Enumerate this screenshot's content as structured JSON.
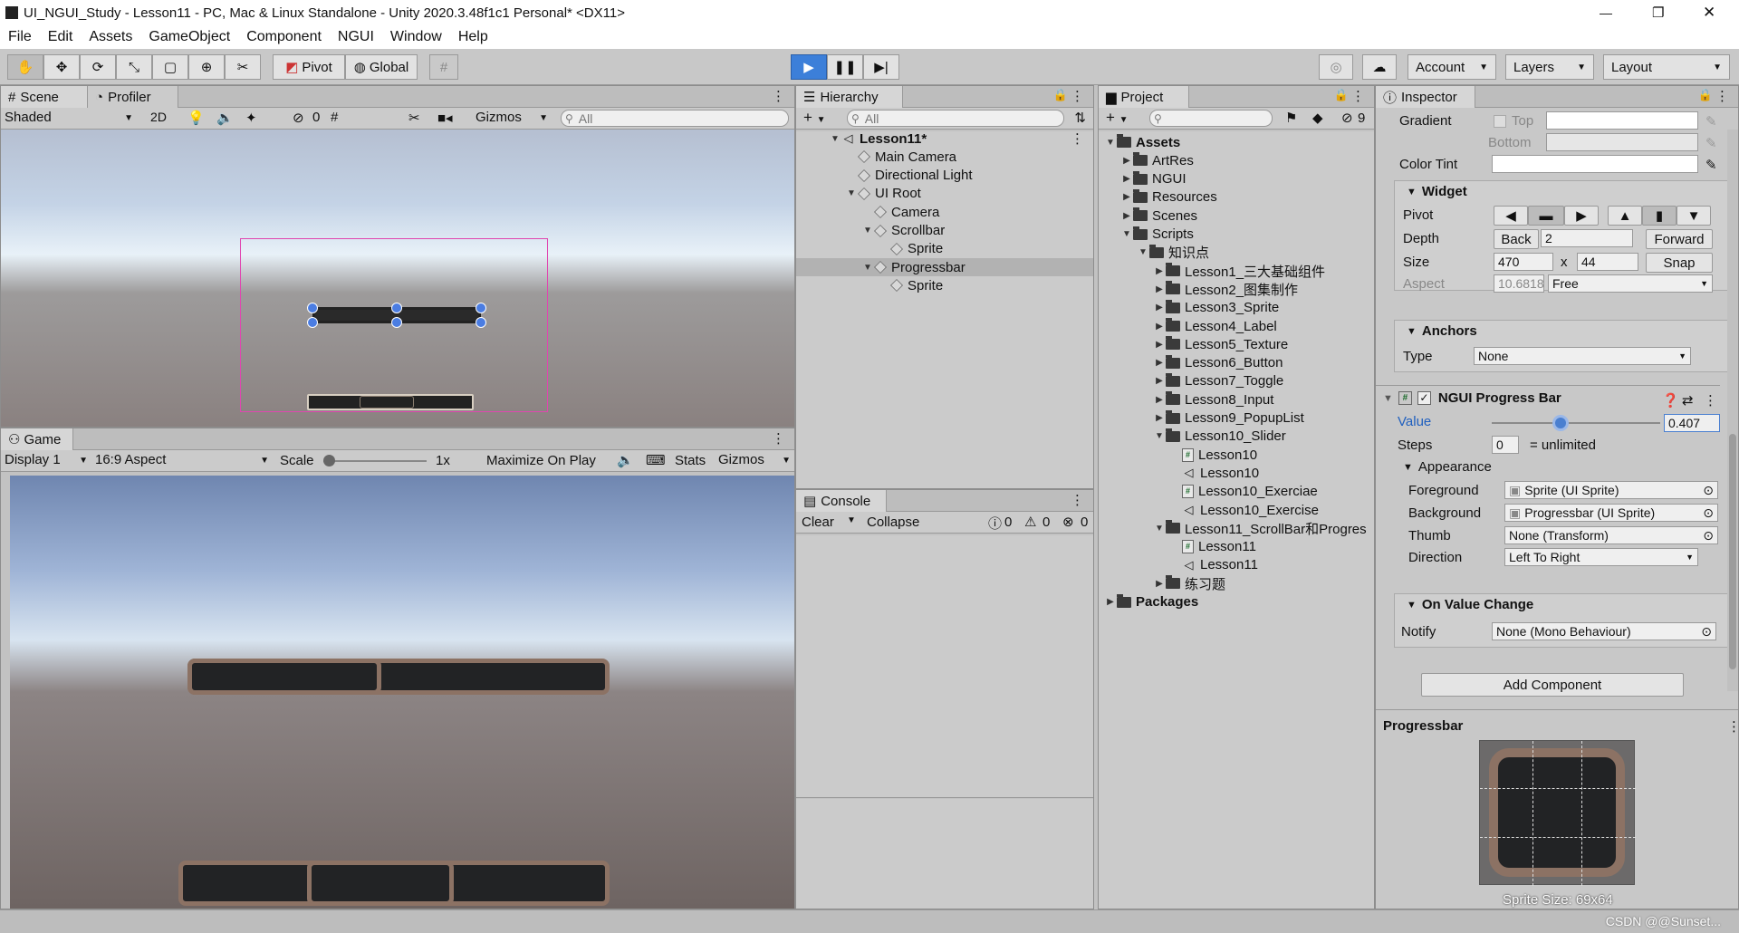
{
  "window": {
    "title": "UI_NGUI_Study - Lesson11 - PC, Mac & Linux Standalone - Unity 2020.3.48f1c1 Personal* <DX11>",
    "controls": [
      "—",
      "❐",
      "✕"
    ]
  },
  "menu": [
    "File",
    "Edit",
    "Assets",
    "GameObject",
    "Component",
    "NGUI",
    "Window",
    "Help"
  ],
  "toolbar": {
    "pivot": "Pivot",
    "global": "Global",
    "account": "Account",
    "layers": "Layers",
    "layout": "Layout"
  },
  "scene": {
    "tab_scene": "Scene",
    "tab_profiler": "Profiler",
    "shading": "Shaded",
    "mode_2d": "2D",
    "gizmos": "Gizmos",
    "search_placeholder": "All",
    "hidden_count": "0"
  },
  "game": {
    "tab": "Game",
    "display": "Display 1",
    "aspect": "16:9 Aspect",
    "scale_label": "Scale",
    "scale_value": "1x",
    "maximize": "Maximize On Play",
    "stats": "Stats",
    "gizmos": "Gizmos"
  },
  "hierarchy": {
    "tab": "Hierarchy",
    "search_placeholder": "All",
    "items": [
      {
        "label": "Lesson11*",
        "depth": 0,
        "fold": "▼",
        "bold": true,
        "type": "scene"
      },
      {
        "label": "Main Camera",
        "depth": 1,
        "fold": "",
        "type": "go"
      },
      {
        "label": "Directional Light",
        "depth": 1,
        "fold": "",
        "type": "go"
      },
      {
        "label": "UI Root",
        "depth": 1,
        "fold": "▼",
        "type": "go"
      },
      {
        "label": "Camera",
        "depth": 2,
        "fold": "",
        "type": "go"
      },
      {
        "label": "Scrollbar",
        "depth": 2,
        "fold": "▼",
        "type": "go"
      },
      {
        "label": "Sprite",
        "depth": 3,
        "fold": "",
        "type": "go"
      },
      {
        "label": "Progressbar",
        "depth": 2,
        "fold": "▼",
        "type": "go",
        "selected": true
      },
      {
        "label": "Sprite",
        "depth": 3,
        "fold": "",
        "type": "go"
      }
    ]
  },
  "console": {
    "tab": "Console",
    "clear": "Clear",
    "collapse": "Collapse",
    "info_count": "0",
    "warn_count": "0",
    "error_count": "0"
  },
  "project": {
    "tab": "Project",
    "badge": "9",
    "items": [
      {
        "label": "Assets",
        "depth": 0,
        "fold": "▼",
        "bold": true,
        "type": "folder"
      },
      {
        "label": "ArtRes",
        "depth": 1,
        "fold": "▶",
        "type": "folder"
      },
      {
        "label": "NGUI",
        "depth": 1,
        "fold": "▶",
        "type": "folder"
      },
      {
        "label": "Resources",
        "depth": 1,
        "fold": "▶",
        "type": "folder"
      },
      {
        "label": "Scenes",
        "depth": 1,
        "fold": "▶",
        "type": "folder"
      },
      {
        "label": "Scripts",
        "depth": 1,
        "fold": "▼",
        "type": "folder"
      },
      {
        "label": "知识点",
        "depth": 2,
        "fold": "▼",
        "type": "folder"
      },
      {
        "label": "Lesson1_三大基础组件",
        "depth": 3,
        "fold": "▶",
        "type": "folder"
      },
      {
        "label": "Lesson2_图集制作",
        "depth": 3,
        "fold": "▶",
        "type": "folder"
      },
      {
        "label": "Lesson3_Sprite",
        "depth": 3,
        "fold": "▶",
        "type": "folder"
      },
      {
        "label": "Lesson4_Label",
        "depth": 3,
        "fold": "▶",
        "type": "folder"
      },
      {
        "label": "Lesson5_Texture",
        "depth": 3,
        "fold": "▶",
        "type": "folder"
      },
      {
        "label": "Lesson6_Button",
        "depth": 3,
        "fold": "▶",
        "type": "folder"
      },
      {
        "label": "Lesson7_Toggle",
        "depth": 3,
        "fold": "▶",
        "type": "folder"
      },
      {
        "label": "Lesson8_Input",
        "depth": 3,
        "fold": "▶",
        "type": "folder"
      },
      {
        "label": "Lesson9_PopupList",
        "depth": 3,
        "fold": "▶",
        "type": "folder"
      },
      {
        "label": "Lesson10_Slider",
        "depth": 3,
        "fold": "▼",
        "type": "folder"
      },
      {
        "label": "Lesson10",
        "depth": 4,
        "fold": "",
        "type": "script"
      },
      {
        "label": "Lesson10",
        "depth": 4,
        "fold": "",
        "type": "scene"
      },
      {
        "label": "Lesson10_Exerciae",
        "depth": 4,
        "fold": "",
        "type": "script"
      },
      {
        "label": "Lesson10_Exercise",
        "depth": 4,
        "fold": "",
        "type": "scene"
      },
      {
        "label": "Lesson11_ScrollBar和Progres",
        "depth": 3,
        "fold": "▼",
        "type": "folder"
      },
      {
        "label": "Lesson11",
        "depth": 4,
        "fold": "",
        "type": "script"
      },
      {
        "label": "Lesson11",
        "depth": 4,
        "fold": "",
        "type": "scene"
      },
      {
        "label": "练习题",
        "depth": 3,
        "fold": "▶",
        "type": "folder"
      },
      {
        "label": "Packages",
        "depth": 0,
        "fold": "▶",
        "bold": true,
        "type": "folder"
      }
    ]
  },
  "inspector": {
    "tab": "Inspector",
    "gradient": {
      "label": "Gradient",
      "top": "Top",
      "bottom": "Bottom"
    },
    "color_tint": "Color Tint",
    "widget": {
      "title": "Widget",
      "pivot": "Pivot",
      "depth_label": "Depth",
      "back": "Back",
      "depth": "2",
      "forward": "Forward",
      "size_label": "Size",
      "width": "470",
      "x": "x",
      "height": "44",
      "snap": "Snap",
      "aspect_label": "Aspect",
      "aspect": "10.6818",
      "aspect_mode": "Free"
    },
    "anchors": {
      "title": "Anchors",
      "type_label": "Type",
      "type": "None"
    },
    "progress": {
      "title": "NGUI Progress Bar",
      "value_label": "Value",
      "value": "0.407",
      "value_fraction": 0.407,
      "steps_label": "Steps",
      "steps": "0",
      "steps_note": "= unlimited",
      "appearance": "Appearance",
      "foreground_label": "Foreground",
      "foreground": "Sprite (UI Sprite)",
      "background_label": "Background",
      "background": "Progressbar (UI Sprite)",
      "thumb_label": "Thumb",
      "thumb": "None (Transform)",
      "direction_label": "Direction",
      "direction": "Left To Right",
      "on_value_change": "On Value Change",
      "notify_label": "Notify",
      "notify": "None (Mono Behaviour)"
    },
    "add_component": "Add Component",
    "preview": {
      "title": "Progressbar",
      "size": "Sprite Size: 69x64"
    }
  },
  "watermark": "CSDN @@Sunset..."
}
